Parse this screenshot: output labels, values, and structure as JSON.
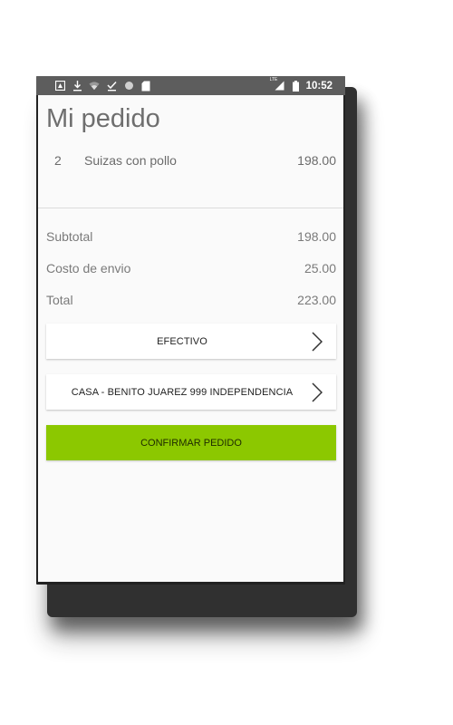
{
  "status_bar": {
    "time": "10:52",
    "network_label": "LTE",
    "left_icons": [
      "notification-icon",
      "download-icon",
      "wifi-icon",
      "check-download-icon",
      "circle-icon",
      "sd-card-icon"
    ],
    "right_icons": [
      "signal-icon",
      "battery-icon"
    ]
  },
  "page": {
    "title": "Mi pedido"
  },
  "order": {
    "items": [
      {
        "qty": "2",
        "name": "Suizas con pollo",
        "price": "198.00"
      }
    ]
  },
  "summary": {
    "subtotal_label": "Subtotal",
    "subtotal_value": "198.00",
    "shipping_label": "Costo de envio",
    "shipping_value": "25.00",
    "total_label": "Total",
    "total_value": "223.00"
  },
  "payment": {
    "label": "EFECTIVO"
  },
  "address": {
    "label": "CASA - BENITO JUAREZ 999 INDEPENDENCIA"
  },
  "confirm": {
    "label": "CONFIRMAR PEDIDO",
    "color": "#8cc800"
  }
}
